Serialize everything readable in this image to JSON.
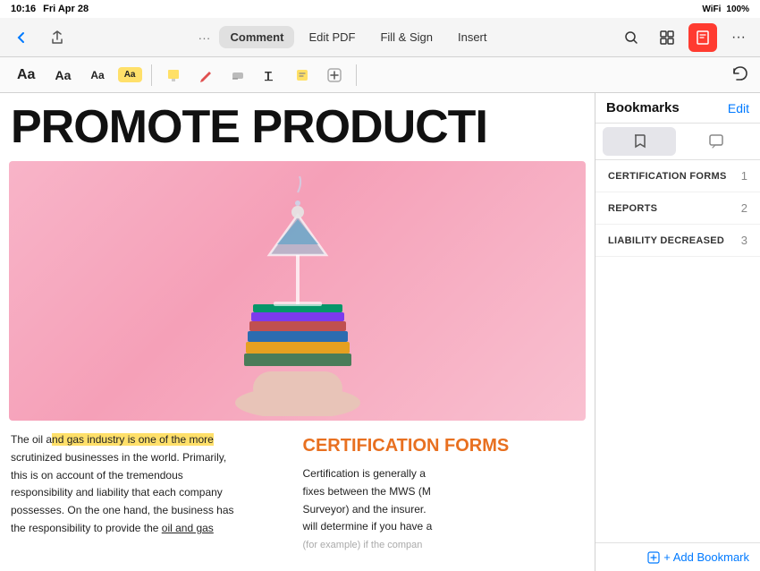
{
  "status_bar": {
    "time": "10:16",
    "day": "Fri Apr 28",
    "wifi": "WiFi",
    "battery": "100%",
    "signal": "●●●●"
  },
  "toolbar": {
    "back_label": "‹",
    "share_label": "⬆",
    "more_label": "···",
    "tabs": [
      {
        "label": "Comment",
        "active": true
      },
      {
        "label": "Edit PDF",
        "active": false
      },
      {
        "label": "Fill & Sign",
        "active": false
      },
      {
        "label": "Insert",
        "active": false
      }
    ],
    "search_label": "⌕",
    "grid_label": "⊞",
    "bookmark_label": "⊟",
    "overflow_label": "···"
  },
  "secondary_toolbar": {
    "text_sizes": [
      {
        "label": "Aa",
        "style": "large",
        "highlighted": false
      },
      {
        "label": "Aa",
        "style": "medium",
        "highlighted": false
      },
      {
        "label": "Aa",
        "style": "small",
        "highlighted": false
      },
      {
        "label": "Aa",
        "style": "xsmall",
        "highlighted": true
      }
    ],
    "tools": [
      {
        "label": "✏",
        "name": "highlight-tool"
      },
      {
        "label": "✒",
        "name": "underline-tool"
      },
      {
        "label": "⊘",
        "name": "strikethrough-tool"
      },
      {
        "label": "T",
        "name": "text-tool"
      },
      {
        "label": "◼",
        "name": "note-tool"
      },
      {
        "label": "⊕",
        "name": "signature-tool"
      }
    ],
    "undo_label": "↩"
  },
  "document": {
    "title": "PROMOTE PRODUCTI",
    "body_left": "The oil and gas industry is one of the more scrutinized businesses in the world. Primarily, this is on account of the tremendous responsibility and liability that each company possesses. On the one hand, the business has the responsibility to provide the oil and gas",
    "highlight_phrase": "nd gas industry is one of the more",
    "cert_heading": "CERTIFICATION FORMS",
    "cert_body": "Certification is generally a fixes between the MWS (M Surveyor) and the insurer. will determine if you have a (for example) if the compan",
    "underline_phrase": "oil and gas"
  },
  "sidebar": {
    "title": "Bookmarks",
    "edit_label": "Edit",
    "tabs": [
      {
        "label": "🔖",
        "name": "bookmark-tab",
        "active": true
      },
      {
        "label": "💬",
        "name": "comment-tab",
        "active": false
      }
    ],
    "bookmarks": [
      {
        "label": "CERTIFICATION FORMS",
        "number": "1"
      },
      {
        "label": "REPORTS",
        "number": "2"
      },
      {
        "label": "LIABILITY DECREASED",
        "number": "3"
      }
    ],
    "add_bookmark_label": "+ Add Bookmark"
  }
}
